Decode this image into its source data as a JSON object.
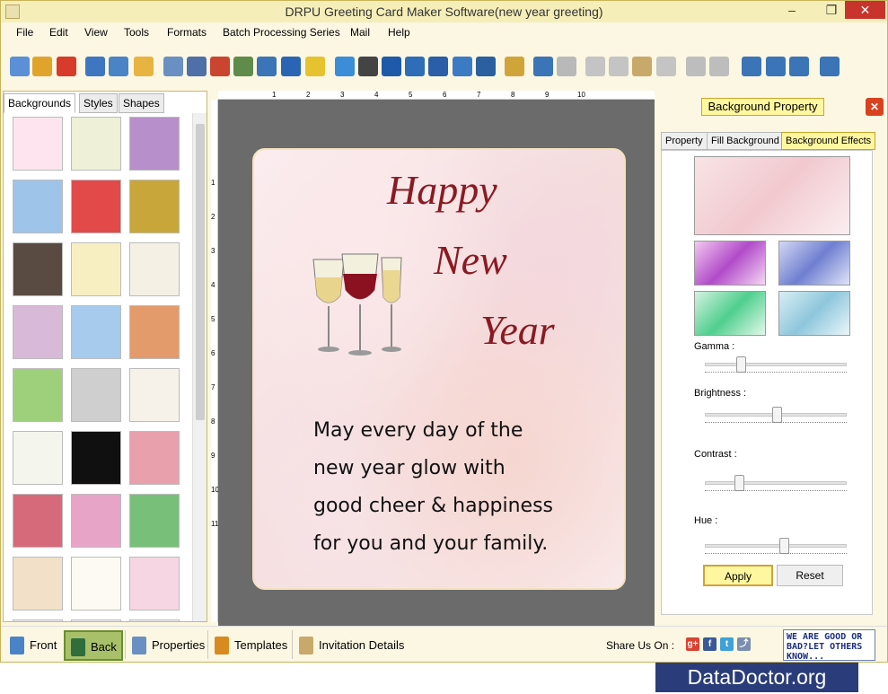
{
  "window": {
    "title": "DRPU Greeting Card Maker Software(new year greeting)",
    "minimize": "–",
    "maximize": "❐",
    "close": "✕"
  },
  "menu": [
    "File",
    "Edit",
    "View",
    "Tools",
    "Formats",
    "Batch Processing Series",
    "Mail",
    "Help"
  ],
  "left_tabs": [
    "Backgrounds",
    "Styles",
    "Shapes"
  ],
  "ruler_h": [
    "1",
    "2",
    "3",
    "4",
    "5",
    "6",
    "7",
    "8",
    "9",
    "10"
  ],
  "ruler_v": [
    "1",
    "2",
    "3",
    "4",
    "5",
    "6",
    "7",
    "8",
    "9",
    "10",
    "11"
  ],
  "card": {
    "line1": "Happy",
    "line2": "New",
    "line3": "Year",
    "message": "May every day of the\nnew year glow with\ngood cheer & happiness\nfor you and your family."
  },
  "right_panel": {
    "title": "Background Property",
    "tabs": [
      "Property",
      "Fill Background",
      "Background Effects"
    ],
    "sliders": [
      {
        "label": "Gamma :",
        "value": 0.23
      },
      {
        "label": "Brightness :",
        "value": 0.5
      },
      {
        "label": "Contrast :",
        "value": 0.22
      },
      {
        "label": "Hue :",
        "value": 0.56
      }
    ],
    "apply": "Apply",
    "reset": "Reset"
  },
  "statusbar": {
    "front": "Front",
    "back": "Back",
    "properties": "Properties",
    "templates": "Templates",
    "invitation": "Invitation Details",
    "share": "Share Us On :",
    "feedback": "WE ARE GOOD OR BAD?LET OTHERS KNOW..."
  },
  "watermark": "DataDoctor.org",
  "colors": {
    "accent": "#fff79f",
    "title_bar": "#f5eeb8",
    "script_red": "#8a1a22"
  }
}
